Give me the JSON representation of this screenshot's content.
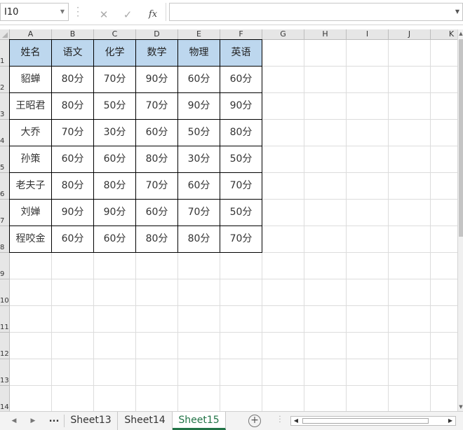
{
  "formula_bar": {
    "name_box": "I10",
    "cancel_icon": "✕",
    "enter_icon": "✓",
    "fx_label": "fx",
    "formula": ""
  },
  "columns": [
    "A",
    "B",
    "C",
    "D",
    "E",
    "F",
    "G",
    "H",
    "I",
    "J",
    "K"
  ],
  "rows": [
    "1",
    "2",
    "3",
    "4",
    "5",
    "6",
    "7",
    "8",
    "9",
    "10",
    "11",
    "12",
    "13",
    "14"
  ],
  "table": {
    "headers": [
      "姓名",
      "语文",
      "化学",
      "数学",
      "物理",
      "英语"
    ],
    "data": [
      [
        "貂蝉",
        "80分",
        "70分",
        "90分",
        "60分",
        "60分"
      ],
      [
        "王昭君",
        "80分",
        "50分",
        "70分",
        "90分",
        "90分"
      ],
      [
        "大乔",
        "70分",
        "30分",
        "60分",
        "50分",
        "80分"
      ],
      [
        "孙策",
        "60分",
        "60分",
        "80分",
        "30分",
        "50分"
      ],
      [
        "老夫子",
        "80分",
        "80分",
        "70分",
        "60分",
        "70分"
      ],
      [
        "刘婵",
        "90分",
        "90分",
        "60分",
        "70分",
        "50分"
      ],
      [
        "程咬金",
        "60分",
        "60分",
        "80分",
        "80分",
        "70分"
      ]
    ]
  },
  "sheet_tabs": {
    "ellipsis": "...",
    "tabs": [
      "Sheet13",
      "Sheet14",
      "Sheet15"
    ],
    "active": "Sheet15",
    "add_icon": "+"
  },
  "colors": {
    "header_fill": "#bdd7ee",
    "active_tab": "#217346"
  }
}
